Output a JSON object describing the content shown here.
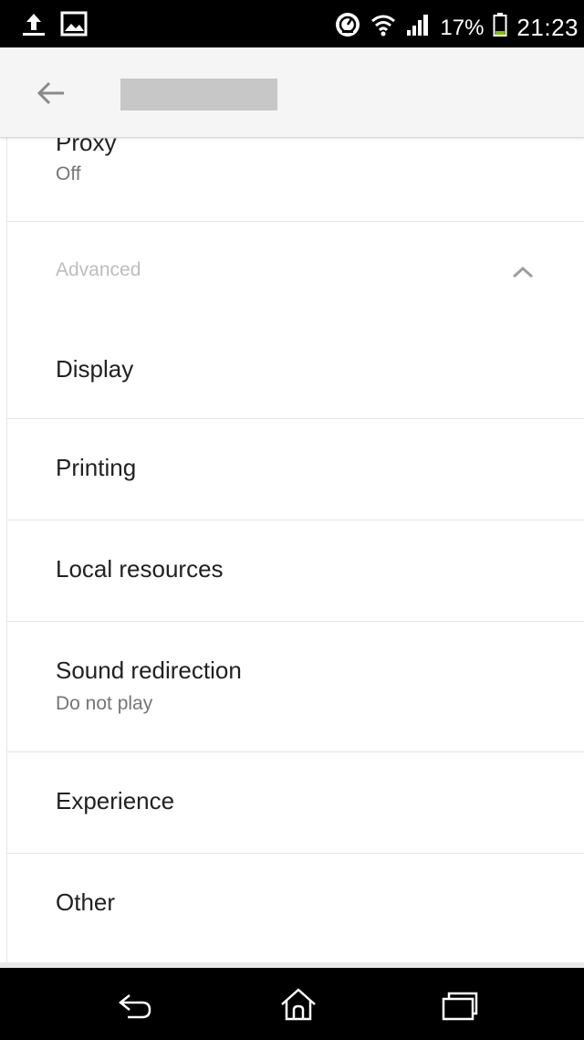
{
  "status_bar": {
    "icons_left": [
      "upload-icon",
      "image-icon"
    ],
    "icons_right": [
      "speedometer-icon",
      "wifi-icon",
      "signal-icon",
      "battery-icon"
    ],
    "battery_percent": "17%",
    "time": "21:23"
  },
  "toolbar": {
    "back_icon": "arrow-left-icon",
    "title_redacted": true
  },
  "proxy": {
    "label": "Proxy",
    "value": "Off"
  },
  "advanced": {
    "header": "Advanced",
    "expanded": true,
    "chevron_icon": "chevron-up-icon"
  },
  "items": [
    {
      "label": "Display",
      "value": ""
    },
    {
      "label": "Printing",
      "value": ""
    },
    {
      "label": "Local resources",
      "value": ""
    },
    {
      "label": "Sound redirection",
      "value": "Do not play"
    },
    {
      "label": "Experience",
      "value": ""
    },
    {
      "label": "Other",
      "value": ""
    }
  ],
  "nav_bar": {
    "icons": [
      "back-icon",
      "home-icon",
      "recents-icon"
    ]
  },
  "colors": {
    "accent_battery": "#7cc000",
    "divider": "#e2e2e2",
    "toolbar_bg": "#f5f5f5"
  }
}
